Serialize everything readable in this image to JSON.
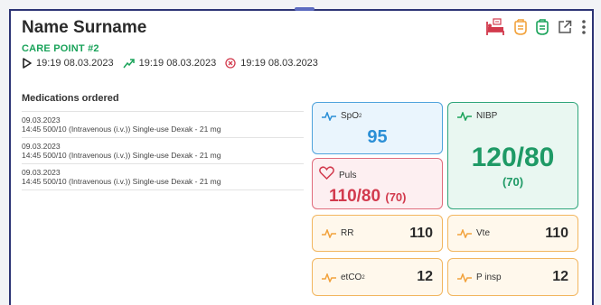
{
  "patient": {
    "name": "Name Surname",
    "care_point": "CARE POINT #2",
    "times": [
      {
        "icon": "play-icon",
        "text": "19:19 08.03.2023"
      },
      {
        "icon": "trend-icon",
        "text": "19:19 08.03.2023"
      },
      {
        "icon": "cancel-circle-icon",
        "text": "19:19 08.03.2023"
      }
    ]
  },
  "header_icons": [
    "bed-icon",
    "bag-icon-orange",
    "bag-icon-green",
    "open-external-icon",
    "more-vertical-icon"
  ],
  "medications": {
    "title": "Medications ordered",
    "items": [
      {
        "date": "09.03.2023",
        "detail": "14:45 500/10 (Intravenous (i.v.)) Single-use Dexak - 21 mg"
      },
      {
        "date": "09.03.2023",
        "detail": "14:45 500/10 (Intravenous (i.v.)) Single-use Dexak - 21 mg"
      },
      {
        "date": "09.03.2023",
        "detail": "14:45 500/10 (Intravenous (i.v.)) Single-use Dexak - 21 mg"
      }
    ]
  },
  "vitals": {
    "spo2": {
      "label": "SpO",
      "sub": "2",
      "value": "95"
    },
    "nibp": {
      "label": "NIBP",
      "value": "120/80",
      "mean": "(70)"
    },
    "puls": {
      "label": "Puls",
      "value": "110/80",
      "mean": "(70)"
    },
    "rr": {
      "label": "RR",
      "value": "110"
    },
    "vte": {
      "label": "Vte",
      "value": "110"
    },
    "etco2": {
      "label": "etCO",
      "sub": "2",
      "value": "12"
    },
    "pinsp": {
      "label": "P insp",
      "value": "12"
    }
  },
  "colors": {
    "green": "#1aa35a",
    "blue": "#2b8fd6",
    "red": "#d23a4d",
    "orange": "#f2a23c",
    "frame": "#2d3475"
  }
}
